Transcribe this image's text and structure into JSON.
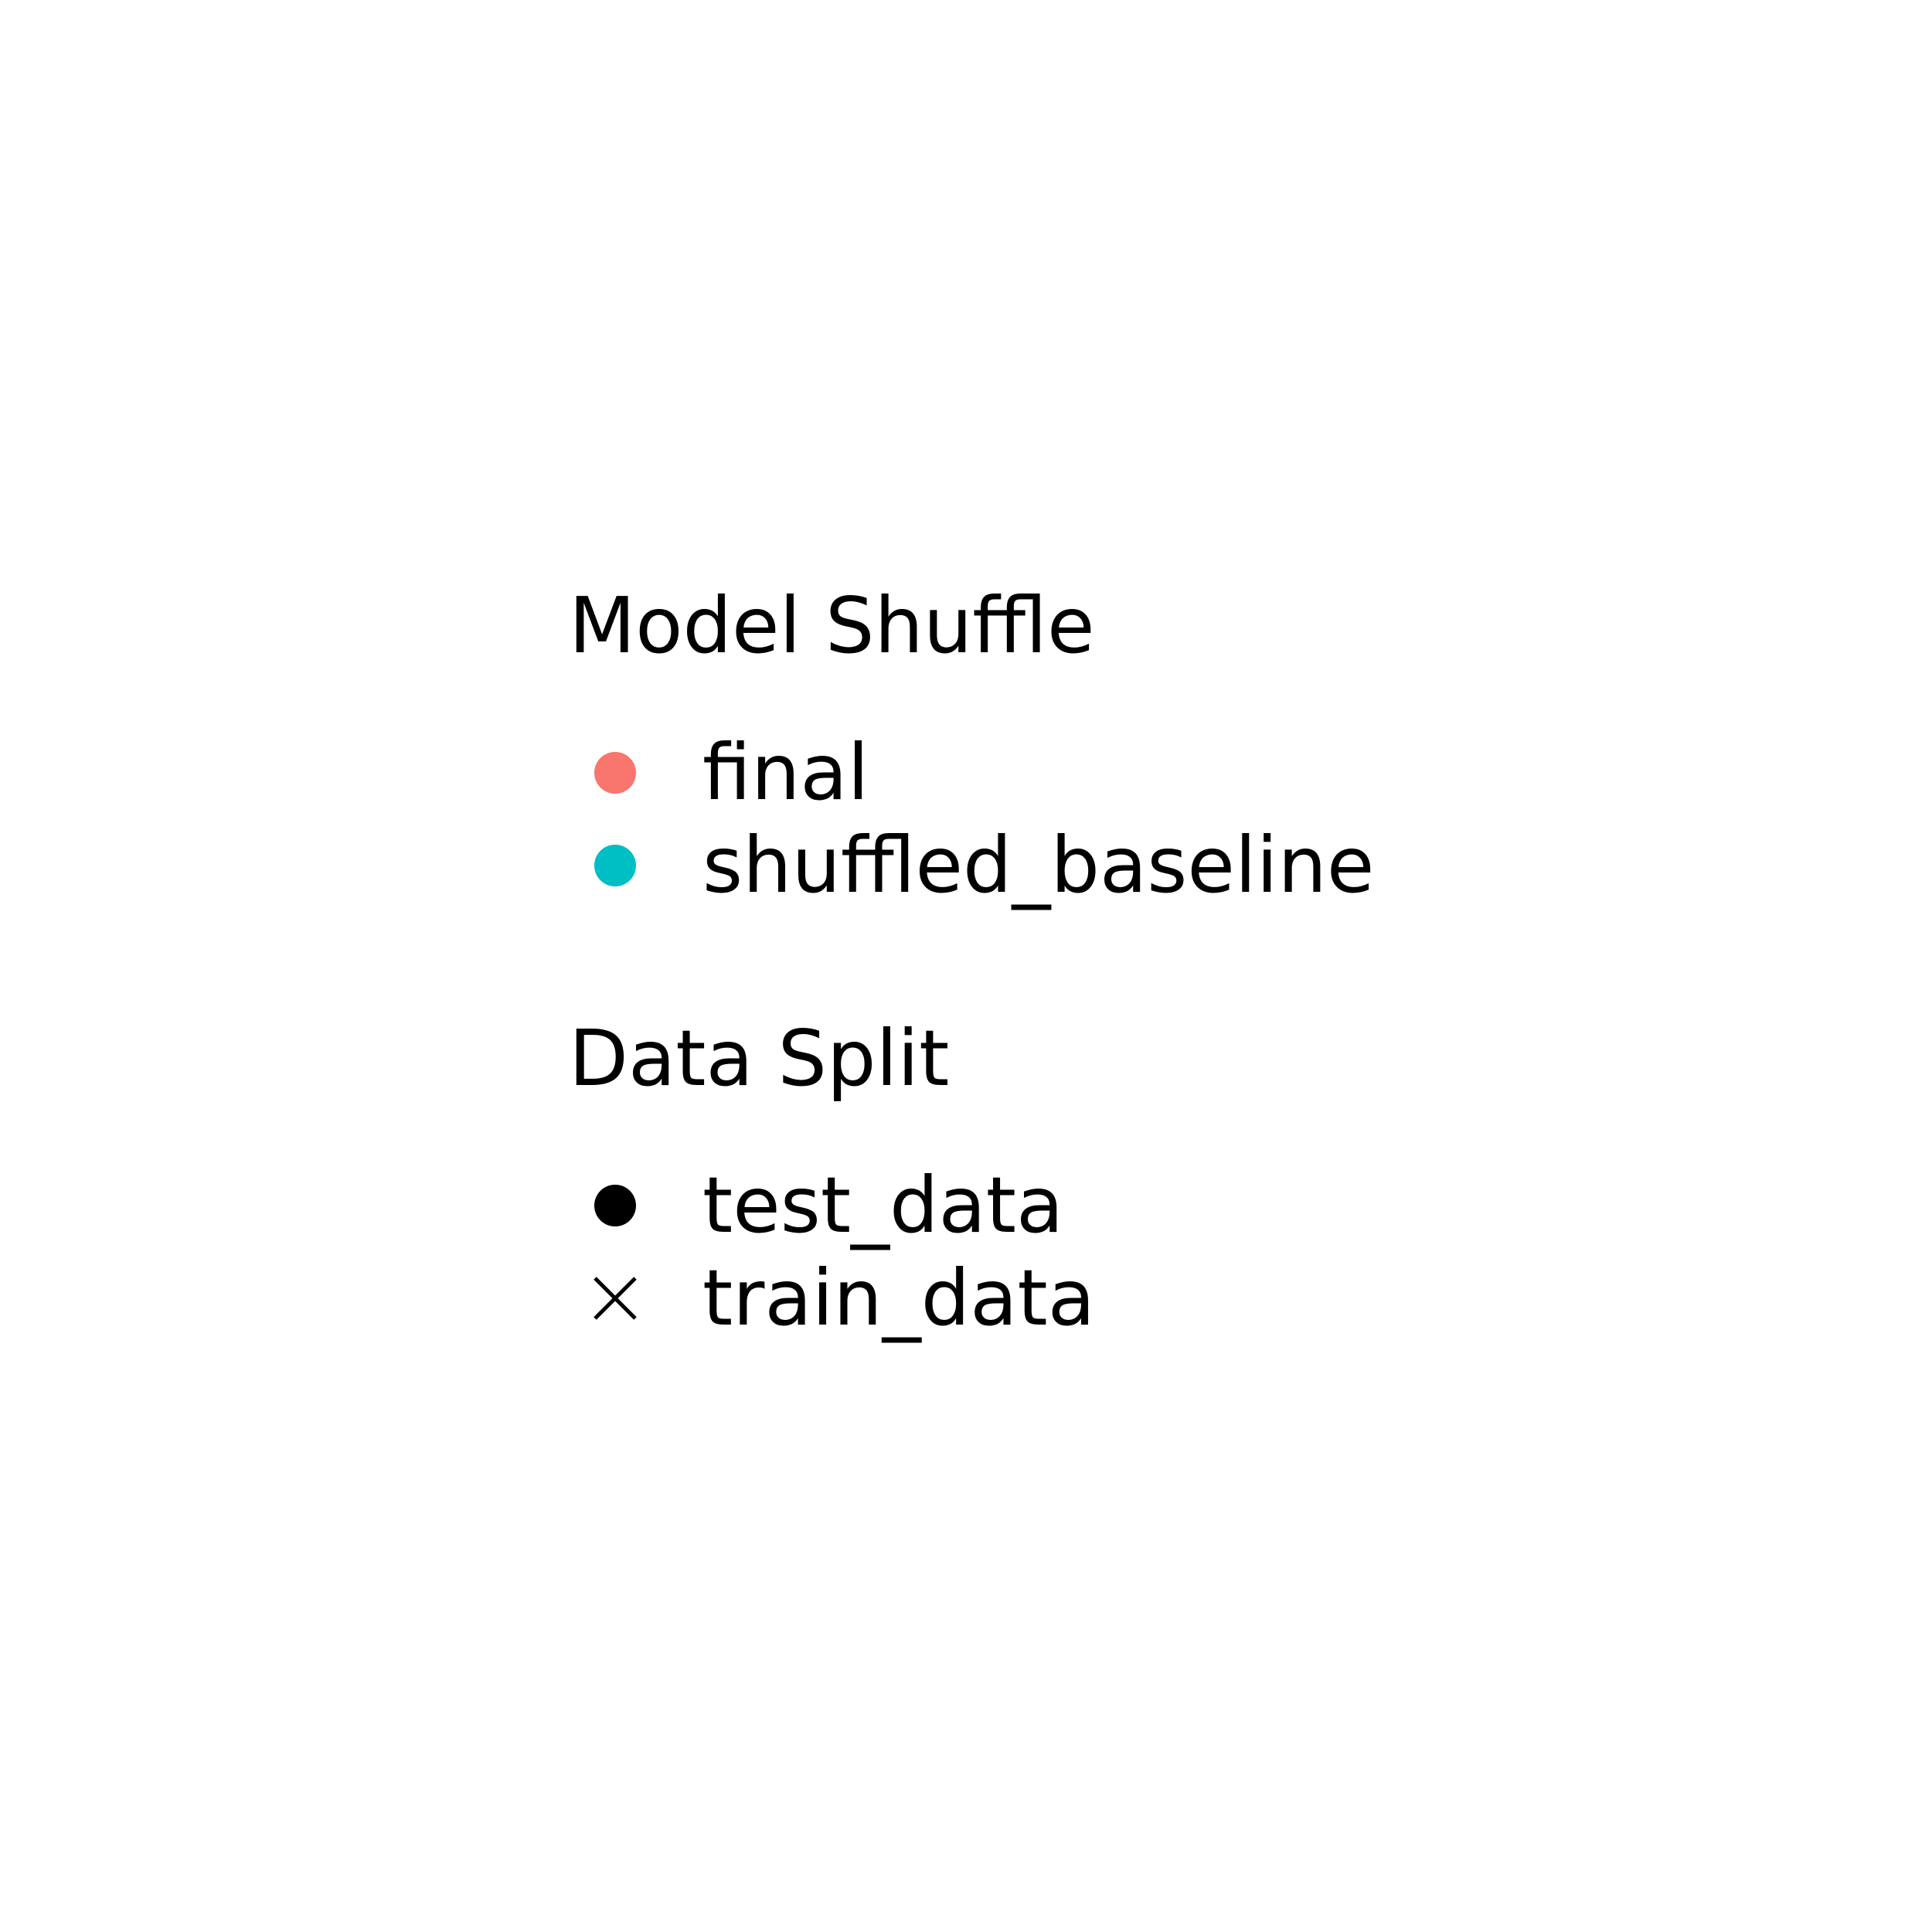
{
  "chart_data": {
    "type": "scatter",
    "legend": [
      {
        "title": "Model Shuffle",
        "entries": [
          {
            "label": "final",
            "shape": "circle",
            "color": "#F8766D"
          },
          {
            "label": "shuffled_baseline",
            "shape": "circle",
            "color": "#00BFC4"
          }
        ]
      },
      {
        "title": "Data Split",
        "entries": [
          {
            "label": "test_data",
            "shape": "circle",
            "color": "#000000"
          },
          {
            "label": "train_data",
            "shape": "cross",
            "color": "#000000"
          }
        ]
      }
    ]
  }
}
